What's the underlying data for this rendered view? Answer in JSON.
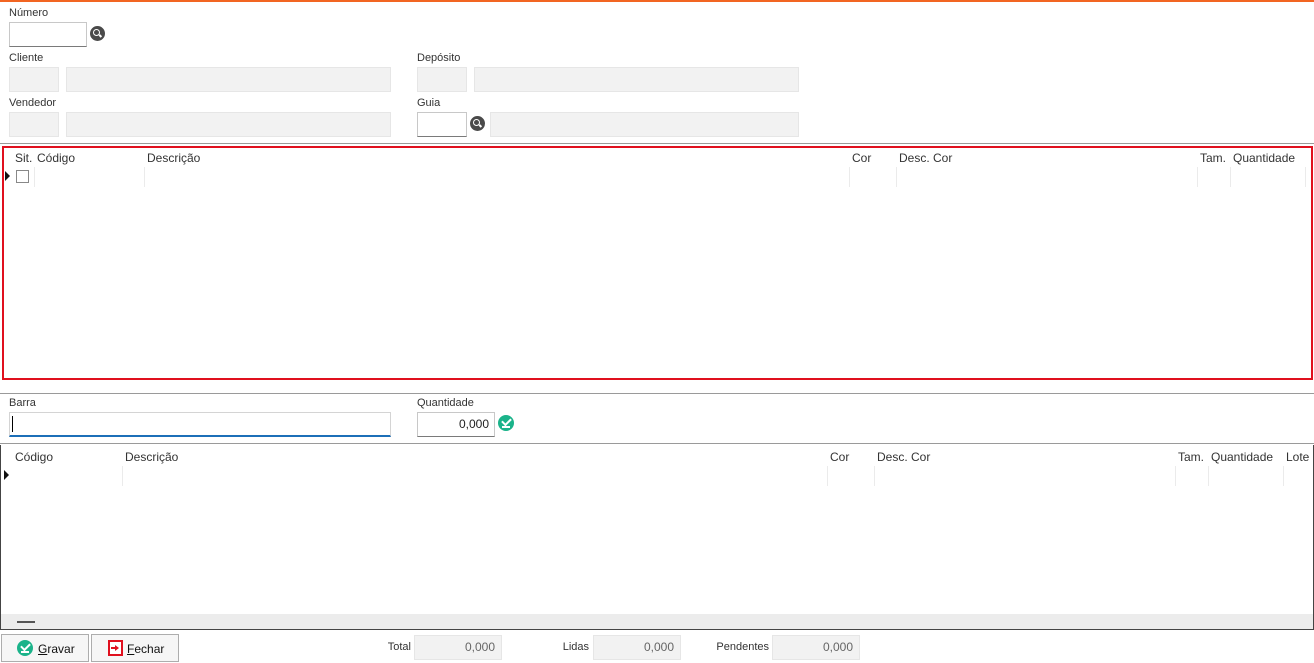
{
  "header": {
    "numero_label": "Número",
    "cliente_label": "Cliente",
    "deposito_label": "Depósito",
    "vendedor_label": "Vendedor",
    "guia_label": "Guia"
  },
  "grid_top": {
    "columns": [
      "Sit.",
      "Código",
      "Descrição",
      "Cor",
      "Desc. Cor",
      "Tam.",
      "Quantidade"
    ]
  },
  "entry": {
    "barra_label": "Barra",
    "quantidade_label": "Quantidade",
    "quantidade_value": "0,000"
  },
  "grid_bottom": {
    "columns": [
      "Código",
      "Descrição",
      "Cor",
      "Desc. Cor",
      "Tam.",
      "Quantidade",
      "Lote"
    ]
  },
  "footer": {
    "gravar_label": "Gravar",
    "fechar_label": "Fechar",
    "total_label": "Total",
    "total_value": "0,000",
    "lidas_label": "Lidas",
    "lidas_value": "0,000",
    "pendentes_label": "Pendentes",
    "pendentes_value": "0,000"
  },
  "colors": {
    "accent": "#f26522",
    "highlight_border": "#e0101e",
    "confirm": "#1bb38a",
    "focus": "#1c6fb8"
  },
  "icons": [
    "search-icon",
    "check-icon",
    "row-indicator-icon",
    "exit-icon"
  ]
}
